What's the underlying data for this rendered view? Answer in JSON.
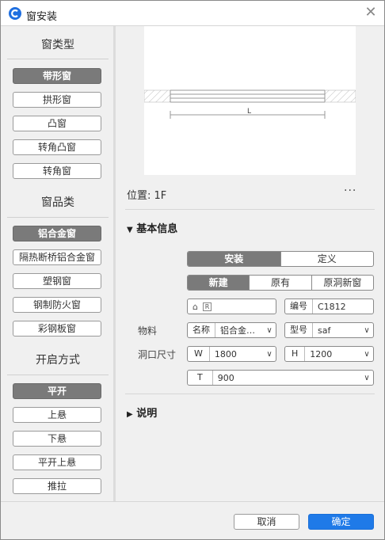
{
  "window": {
    "title": "窗安装"
  },
  "left": {
    "sections": [
      {
        "title": "窗类型",
        "items": [
          "带形窗",
          "拱形窗",
          "凸窗",
          "转角凸窗",
          "转角窗"
        ],
        "selected": 0
      },
      {
        "title": "窗品类",
        "items": [
          "铝合金窗",
          "隔热断桥铝合金窗",
          "塑钢窗",
          "钢制防火窗",
          "彩钢板窗"
        ],
        "selected": 0
      },
      {
        "title": "开启方式",
        "items": [
          "平开",
          "上悬",
          "下悬",
          "平开上悬",
          "推拉"
        ],
        "selected": 0
      }
    ]
  },
  "preview": {
    "dimension_label": "L"
  },
  "position": {
    "label": "位置: 1F",
    "more": "···"
  },
  "basic": {
    "title": "基本信息",
    "tabs1": [
      "安装",
      "定义"
    ],
    "tabs2": [
      "新建",
      "原有",
      "原洞新窗"
    ],
    "number_label": "编号",
    "number_value": "C1812",
    "material_label": "物料",
    "name_label": "名称",
    "name_value": "铝合金…",
    "model_label": "型号",
    "model_value": "saf",
    "opening_label": "洞口尺寸",
    "w_label": "W",
    "w_value": "1800",
    "h_label": "H",
    "h_value": "1200",
    "t_label": "T",
    "t_value": "900"
  },
  "desc": {
    "title": "说明"
  },
  "footer": {
    "cancel": "取消",
    "ok": "确定"
  },
  "colors": {
    "accent": "#1f7ae8",
    "selected": "#7a7a7a"
  }
}
